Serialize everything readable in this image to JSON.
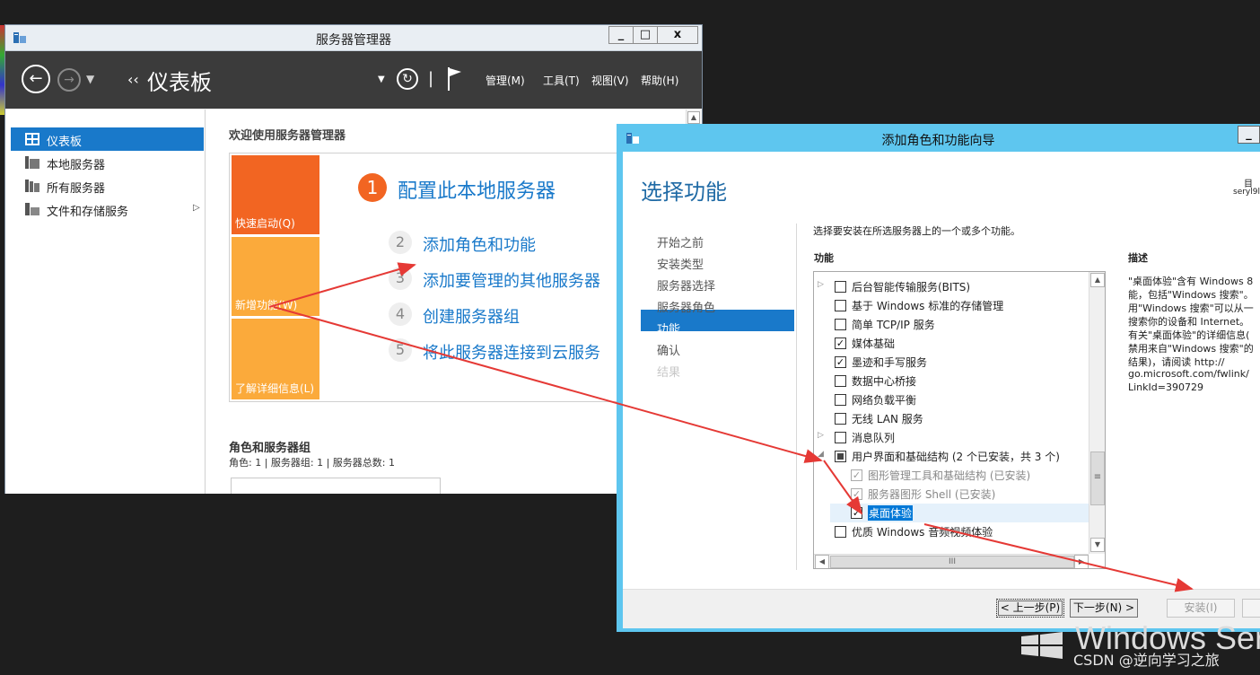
{
  "server_manager": {
    "title": "服务器管理器",
    "caption_buttons": {
      "minimize": "_",
      "maximize": "□",
      "close": "x"
    },
    "breadcrumb_sep": "‹‹",
    "breadcrumb": "仪表板",
    "menus": [
      "管理(M)",
      "工具(T)",
      "视图(V)",
      "帮助(H)"
    ],
    "sidebar": [
      {
        "label": "仪表板",
        "icon": "dashboard-icon",
        "selected": true
      },
      {
        "label": "本地服务器",
        "icon": "server-icon"
      },
      {
        "label": "所有服务器",
        "icon": "servers-icon"
      },
      {
        "label": "文件和存储服务",
        "icon": "storage-icon",
        "expandable": true
      }
    ],
    "welcome_title": "欢迎使用服务器管理器",
    "tiles": [
      "快速启动(Q)",
      "新增功能(W)",
      "了解详细信息(L)"
    ],
    "steps": [
      {
        "num": "1",
        "label": "配置此本地服务器"
      },
      {
        "num": "2",
        "label": "添加角色和功能"
      },
      {
        "num": "3",
        "label": "添加要管理的其他服务器"
      },
      {
        "num": "4",
        "label": "创建服务器组"
      },
      {
        "num": "5",
        "label": "将此服务器连接到云服务"
      }
    ],
    "roles_title": "角色和服务器组",
    "roles_summary": "角色: 1 | 服务器组: 1 | 服务器总数: 1"
  },
  "wizard": {
    "title": "添加角色和功能向导",
    "heading": "选择功能",
    "dest_line1": "目",
    "dest_line2": "seryl9l",
    "steps": [
      {
        "label": "开始之前",
        "state": "normal"
      },
      {
        "label": "安装类型",
        "state": "normal"
      },
      {
        "label": "服务器选择",
        "state": "normal"
      },
      {
        "label": "服务器角色",
        "state": "normal"
      },
      {
        "label": "功能",
        "state": "selected"
      },
      {
        "label": "确认",
        "state": "normal"
      },
      {
        "label": "结果",
        "state": "disabled"
      }
    ],
    "instruction": "选择要安装在所选服务器上的一个或多个功能。",
    "features_header": "功能",
    "description_header": "描述",
    "description_lines": [
      "\"桌面体验\"含有 Windows 8",
      "能，包括\"Windows 搜索\"。",
      "用\"Windows 搜索\"可以从一",
      "搜索你的设备和 Internet。",
      "有关\"桌面体验\"的详细信息(",
      "禁用来自\"Windows 搜索\"的",
      "结果)，请阅读 http://",
      "go.microsoft.com/fwlink/",
      "LinkId=390729"
    ],
    "features": [
      {
        "label": "后台智能传输服务(BITS)",
        "expand": "▷",
        "state": "unchecked",
        "indent": 0
      },
      {
        "label": "基于 Windows 标准的存储管理",
        "expand": "",
        "state": "unchecked",
        "indent": 0
      },
      {
        "label": "简单 TCP/IP 服务",
        "expand": "",
        "state": "unchecked",
        "indent": 0
      },
      {
        "label": "媒体基础",
        "expand": "",
        "state": "checked",
        "indent": 0
      },
      {
        "label": "墨迹和手写服务",
        "expand": "",
        "state": "checked",
        "indent": 0
      },
      {
        "label": "数据中心桥接",
        "expand": "",
        "state": "unchecked",
        "indent": 0
      },
      {
        "label": "网络负载平衡",
        "expand": "",
        "state": "unchecked",
        "indent": 0
      },
      {
        "label": "无线 LAN 服务",
        "expand": "",
        "state": "unchecked",
        "indent": 0
      },
      {
        "label": "消息队列",
        "expand": "▷",
        "state": "unchecked",
        "indent": 0
      },
      {
        "label": "用户界面和基础结构 (2 个已安装，共 3 个)",
        "expand": "◢",
        "state": "partial",
        "indent": 0
      },
      {
        "label": "图形管理工具和基础结构 (已安装)",
        "expand": "",
        "state": "checked-grey",
        "indent": 1
      },
      {
        "label": "服务器图形 Shell (已安装)",
        "expand": "",
        "state": "checked-grey",
        "indent": 1
      },
      {
        "label": "桌面体验",
        "expand": "",
        "state": "checked",
        "indent": 1,
        "highlight": true
      },
      {
        "label": "优质 Windows 音频视频体验",
        "expand": "",
        "state": "unchecked",
        "indent": 0
      }
    ],
    "buttons": {
      "prev": "< 上一步(P)",
      "next": "下一步(N) >",
      "install": "安装(I)"
    }
  },
  "desktop": {
    "brand": "Windows Ser",
    "watermark": "CSDN @逆向学习之旅"
  },
  "colors": {
    "accent": "#1979ca",
    "tile_orange": "#f26522",
    "tile_amber": "#fbaa3b",
    "wizard_frame": "#5ec6ef",
    "annotation_arrow": "#e53935"
  }
}
